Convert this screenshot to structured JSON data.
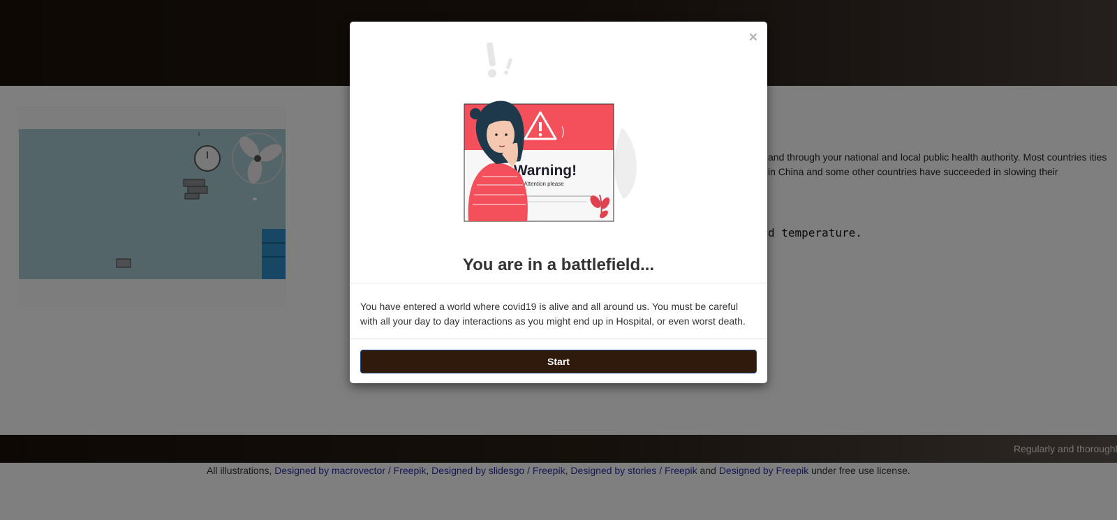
{
  "main": {
    "paragraph": "and through your national and local public health authority. Most countries ities in China and some other countries have succeeded in slowing their",
    "temperature_line": "d temperature."
  },
  "ticker": {
    "text": "Regularly and thoroughl"
  },
  "credits": {
    "prefix": "All illustrations, ",
    "link1": "Designed by macrovector / Freepik",
    "sep1": ", ",
    "link2": "Designed by slidesgo / Freepik",
    "sep2": ", ",
    "link3": "Designed by stories / Freepik",
    "sep3": " and ",
    "link4": "Designed by Freepik",
    "suffix": " under free use license."
  },
  "modal": {
    "close": "×",
    "illustration": {
      "heading": "Warning!",
      "subheading": "Attention please",
      "icon": "warning-triangle-icon"
    },
    "title": "You are in a battlefield...",
    "body": "You have entered a world where covid19 is alive and all around us. You must be careful with all your day to day interactions as you might end up in Hospital, or even worst death.",
    "start_label": "Start"
  },
  "colors": {
    "header_dark": "#1b1108",
    "button_bg": "#2f1a0b",
    "warning_red": "#f4505c",
    "scene_bg": "#a6cbd2",
    "link": "#2a2fa8"
  }
}
